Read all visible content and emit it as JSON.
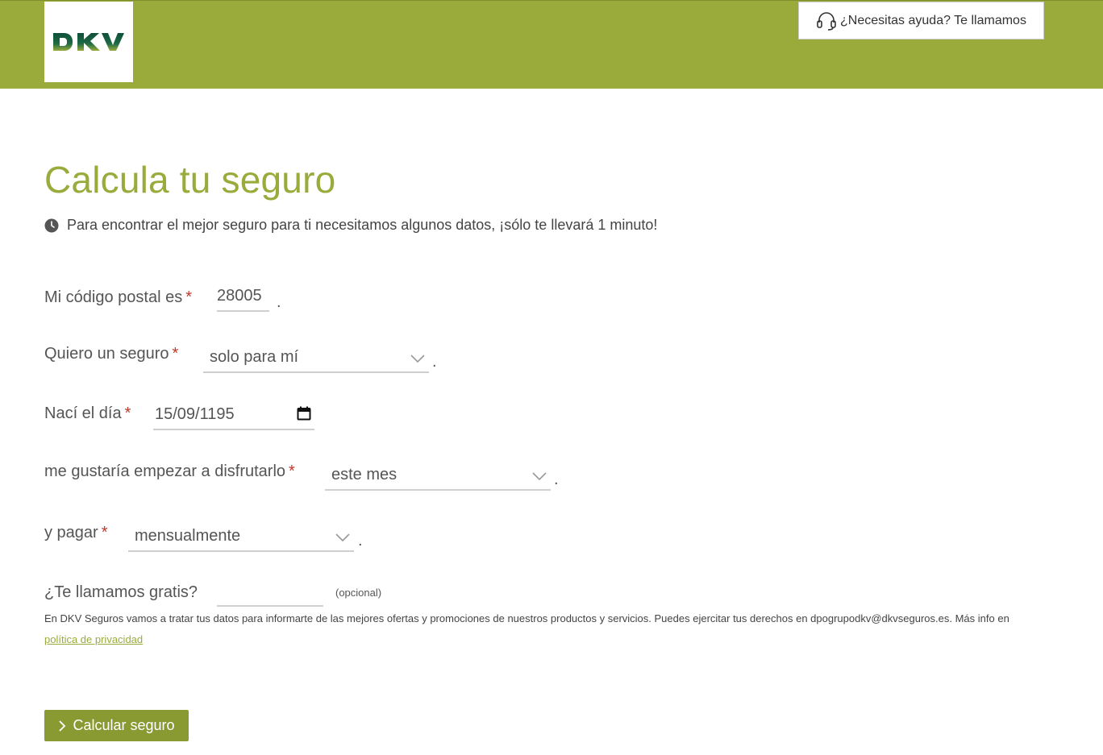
{
  "header": {
    "logo_text": "DKV",
    "help_label": "¿Necesitas ayuda? Te llamamos"
  },
  "page": {
    "title": "Calcula tu seguro",
    "intro": "Para encontrar el mejor seguro para ti necesitamos algunos datos, ¡sólo te llevará 1 minuto!"
  },
  "form": {
    "required_mark": "*",
    "period": ".",
    "postal": {
      "label": "Mi código postal es",
      "value": "28005"
    },
    "insurance_for": {
      "label": "Quiero un seguro",
      "value": "solo para mí"
    },
    "birth": {
      "label": "Nací el día",
      "value": "15/09/1195"
    },
    "start": {
      "label": "me gustaría empezar a disfrutarlo",
      "value": "este mes"
    },
    "payment": {
      "label": "y pagar",
      "value": "mensualmente"
    },
    "phone": {
      "label": "¿Te llamamos gratis?",
      "value": "",
      "optional": "(opcional)"
    }
  },
  "legal": {
    "text": "En DKV Seguros vamos a tratar tus datos para informarte de las mejores ofertas y promociones de nuestros productos y servicios. Puedes ejercitar tus derechos en dpogrupodkv@dkvseguros.es. Más info en",
    "link": "política de privacidad"
  },
  "submit_label": "Calcular seguro",
  "colors": {
    "brand": "#9aab3c",
    "button": "#8a9a33",
    "required": "#c0392b",
    "logo_dark": "#0f4f3a"
  },
  "icons": [
    "headset-icon",
    "clock-icon",
    "chevron-down-icon",
    "calendar-icon",
    "chevron-right-icon"
  ]
}
